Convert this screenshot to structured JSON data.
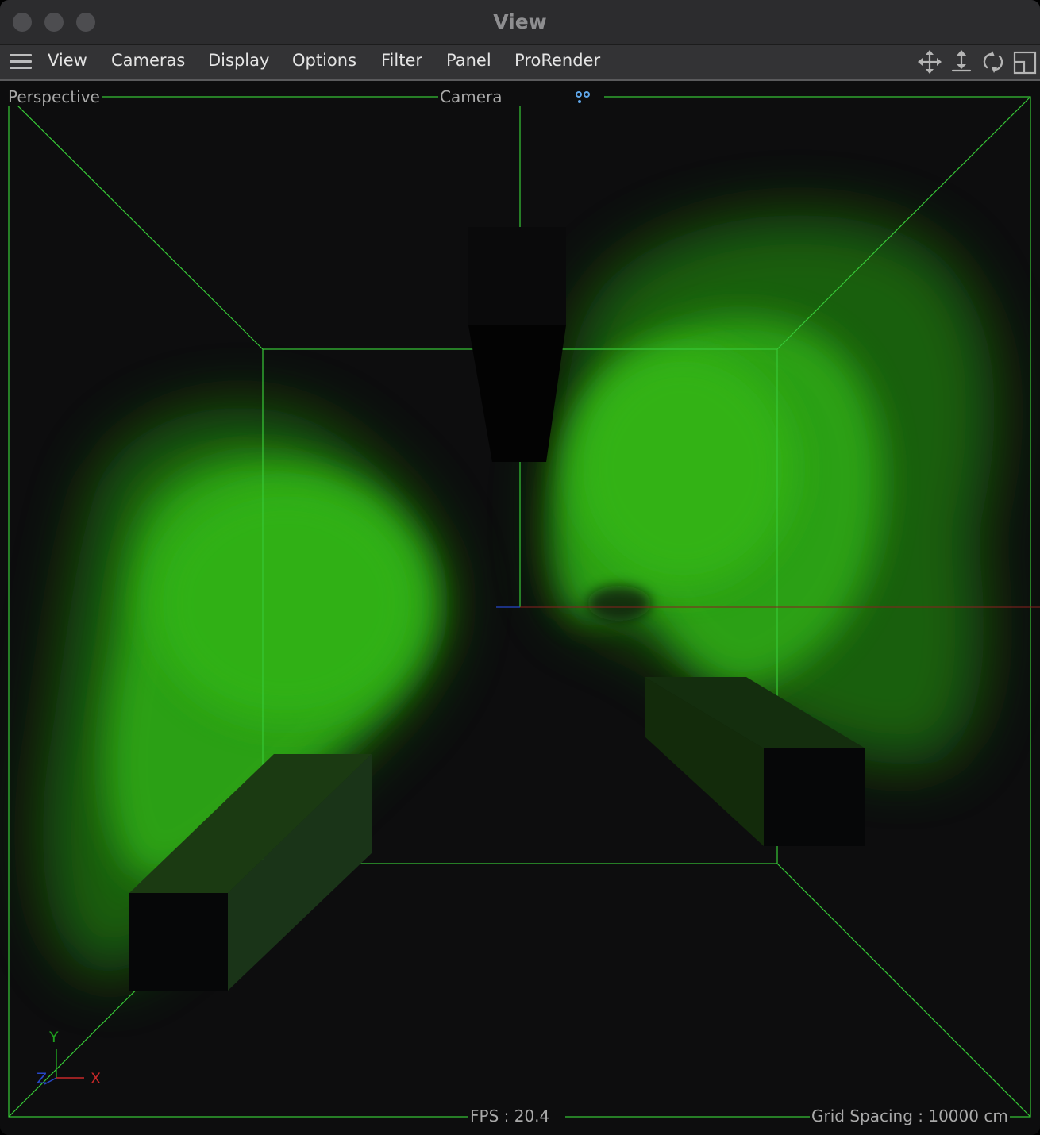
{
  "window": {
    "title": "View"
  },
  "menu": {
    "items": [
      {
        "id": "view",
        "label": "View"
      },
      {
        "id": "cameras",
        "label": "Cameras"
      },
      {
        "id": "display",
        "label": "Display"
      },
      {
        "id": "options",
        "label": "Options"
      },
      {
        "id": "filter",
        "label": "Filter"
      },
      {
        "id": "panel",
        "label": "Panel"
      },
      {
        "id": "prorender",
        "label": "ProRender"
      }
    ]
  },
  "toolbar": {
    "icons": [
      "move-icon",
      "zoom-icon",
      "rotate-icon",
      "maximize-panel-icon"
    ]
  },
  "viewport": {
    "projection": "Perspective",
    "camera": "Camera",
    "fps": "FPS : 20.4",
    "grid_spacing": "Grid Spacing : 10000 cm",
    "axes": {
      "x": "X",
      "y": "Y",
      "z": "Z"
    }
  },
  "colors": {
    "bounding_box": "#37c837",
    "smoke": "#32b010",
    "axis_x": "#c62828",
    "axis_y": "#1fa01f",
    "axis_z": "#2747c8"
  }
}
